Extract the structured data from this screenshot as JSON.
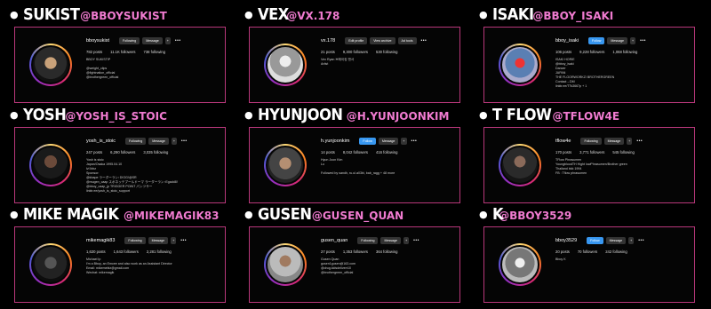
{
  "profiles": [
    {
      "name": "SUKIST",
      "handle": "@BBOYSUKIST",
      "username": "bboysukist",
      "buttons": [
        "Following",
        "Message",
        "+"
      ],
      "stats": {
        "posts": "782 posts",
        "followers": "11.1K followers",
        "following": "738 following"
      },
      "bio": [
        "BBOY SUKISTIP",
        "",
        "@weight_clips",
        "@fightnation_official",
        "@brothergreen_official"
      ]
    },
    {
      "name": "VEX",
      "handle": "@VX.178",
      "username": "vx.178",
      "buttons": [
        "Edit profile",
        "View archive",
        "Ad tools"
      ],
      "stats": {
        "posts": "21 posts",
        "followers": "9,300 followers",
        "following": "530 following"
      },
      "bio": [
        "Vex Ryan 브레이킹 댄서 ",
        "Artist"
      ]
    },
    {
      "name": "ISAKI",
      "handle": "@BBOY_ISAKI",
      "username": "bboy_isaki",
      "buttons": [
        "Follow",
        "Message",
        "+"
      ],
      "stats": {
        "posts": "106 posts",
        "followers": "9,228 followers",
        "following": "1,068 following"
      },
      "bio": [
        "ISAKI HORIE",
        "@bboy_isaki",
        "Dancer",
        "JAPAN",
        "THE FLOORWORKZ/ BROTHERGREEN",
        "Contact→DM",
        "linktr.ee/TTs3667p + 1"
      ]
    },
    {
      "name": "YOSH",
      "handle": "@YOSH_IS_STOIC",
      "username": "yosh_is_stoic",
      "buttons": [
        "Following",
        "Message",
        "+"
      ],
      "stats": {
        "posts": "247 posts",
        "followers": "6,290 followers",
        "following": "3,035 following"
      },
      "bio": [
        "Yosh is stoic",
        "Japan/Osaka 1995.04.10",
        "lvl lbbz",
        "Sponsor:",
        "@kbape ラーダーラン↑D!OG!@SR",
        "@mugen_caap スポネッテプールドーマ ラーダーラン↑Egadd8!",
        "@bboy_caap_jp TRIGGER POINT パンツサー",
        "linktr.ee/yosh_is_stoic_support"
      ]
    },
    {
      "name": "HYUNJOON",
      "handle": "@H.YUNJOONKIM",
      "username": "h.yunjoonkim",
      "buttons": [
        "Follow",
        "Message",
        "+"
      ],
      "stats": {
        "posts": "14 posts",
        "followers": "8,042 followers",
        "following": "416 following"
      },
      "bio": [
        "Hyun Joon Kim",
        "Lo",
        "",
        "Followed by sandh, ru.ul.a03bi, bab_ragg + 48 more"
      ]
    },
    {
      "name": "T FLOW",
      "handle": "@TFLOW4E",
      "username": "tflow4e",
      "buttons": [
        "Following",
        "Message",
        "+"
      ],
      "stats": {
        "posts": "170 posts",
        "followers": "3,771 followers",
        "following": "545 following"
      },
      "bio": [
        "TFlow Phrasumen",
        "YoungbloodTH Hight lowPhrasumen/Brother green",
        "Thailand bkk 1994",
        "FB : Tflow phrasumen"
      ]
    },
    {
      "name": "MIKE MAGIK",
      "handle": "@MIKEMAGIK83",
      "username": "mikemagik83",
      "buttons": [
        "Following",
        "Message",
        "+"
      ],
      "stats": {
        "posts": "1,620 posts",
        "followers": "1,643 followers",
        "following": "2,281 following"
      },
      "bio": [
        "Michael Ip",
        "I'm a Bboy, an Emcee and also work as an Assistant Director",
        "Email: mikemebiz@gmail.com",
        "Wechat: mikemagik"
      ]
    },
    {
      "name": "GUSEN",
      "handle": "@GUSEN_QUAN",
      "username": "gusen_quan",
      "buttons": [
        "Following",
        "Message",
        "+"
      ],
      "stats": {
        "posts": "27 posts",
        "followers": "1,353 followers",
        "following": "364 following"
      },
      "bio": [
        "Gusen Quan",
        "gusen1gusen@163.com",
        "@drug.kidsdeliverr10",
        "@brothergreen_official"
      ]
    },
    {
      "name": "K",
      "handle": "@BBOY3529",
      "username": "bboy3529",
      "buttons": [
        "Follow",
        "Message",
        "+"
      ],
      "stats": {
        "posts": "20 posts",
        "followers": "70 followers",
        "following": "242 following"
      },
      "bio": [
        "Bboy K"
      ]
    }
  ],
  "colors": {
    "handle": "#f07bd0",
    "card_border": "#b8377a",
    "follow_blue": "#3897f0",
    "background": "#000000"
  }
}
